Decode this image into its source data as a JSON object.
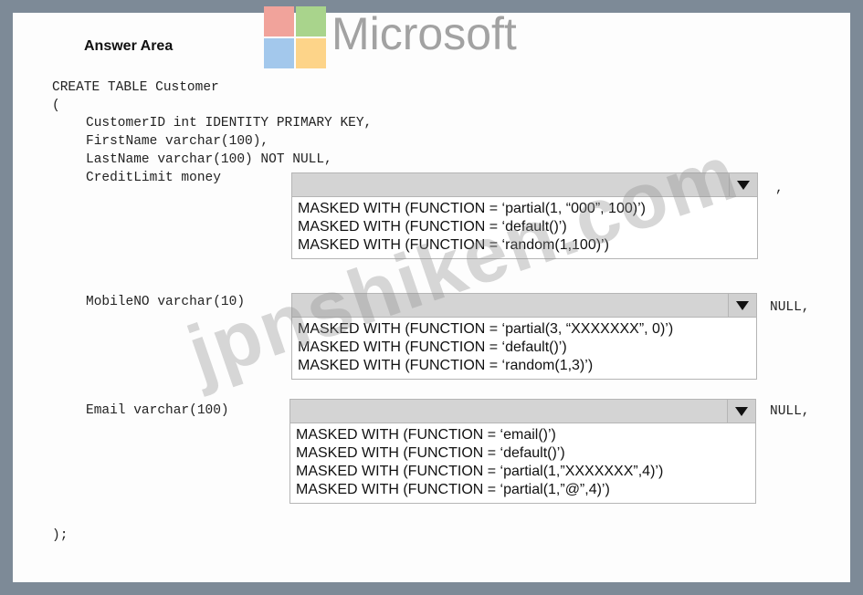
{
  "logo": {
    "text": "Microsoft"
  },
  "answer_area": {
    "title": "Answer Area"
  },
  "code": {
    "line1": "CREATE TABLE Customer",
    "line2": "(",
    "line3": "CustomerID int IDENTITY PRIMARY KEY,",
    "line4": "FirstName varchar(100),",
    "line5": "LastName varchar(100) NOT NULL,",
    "line6": "CreditLimit money",
    "after_credit": ",",
    "mobile": "MobileNO varchar(10)",
    "after_mobile": "NULL,",
    "email": "Email varchar(100)",
    "after_email": "NULL,",
    "close": ");"
  },
  "dropdowns": {
    "credit": {
      "selected": "",
      "options": [
        "MASKED WITH (FUNCTION = ‘partial(1, “000”, 100)’)",
        "MASKED WITH (FUNCTION = ‘default()’)",
        "MASKED WITH (FUNCTION = ‘random(1,100)’)"
      ]
    },
    "mobile": {
      "selected": "",
      "options": [
        "MASKED WITH (FUNCTION = ‘partial(3, “XXXXXXX”, 0)’)",
        "MASKED WITH (FUNCTION = ‘default()’)",
        "MASKED WITH (FUNCTION = ‘random(1,3)’)"
      ]
    },
    "email": {
      "selected": "",
      "options": [
        "MASKED WITH (FUNCTION = ‘email()’)",
        "MASKED WITH (FUNCTION = ‘default()’)",
        "MASKED WITH (FUNCTION = ‘partial(1,”XXXXXXX”,4)’)",
        "MASKED WITH (FUNCTION = ‘partial(1,”@”,4)’)"
      ]
    }
  },
  "watermark": {
    "text": "jpnshiken.com"
  },
  "icons": {
    "dropdown_arrow": "triangle-down-icon"
  }
}
